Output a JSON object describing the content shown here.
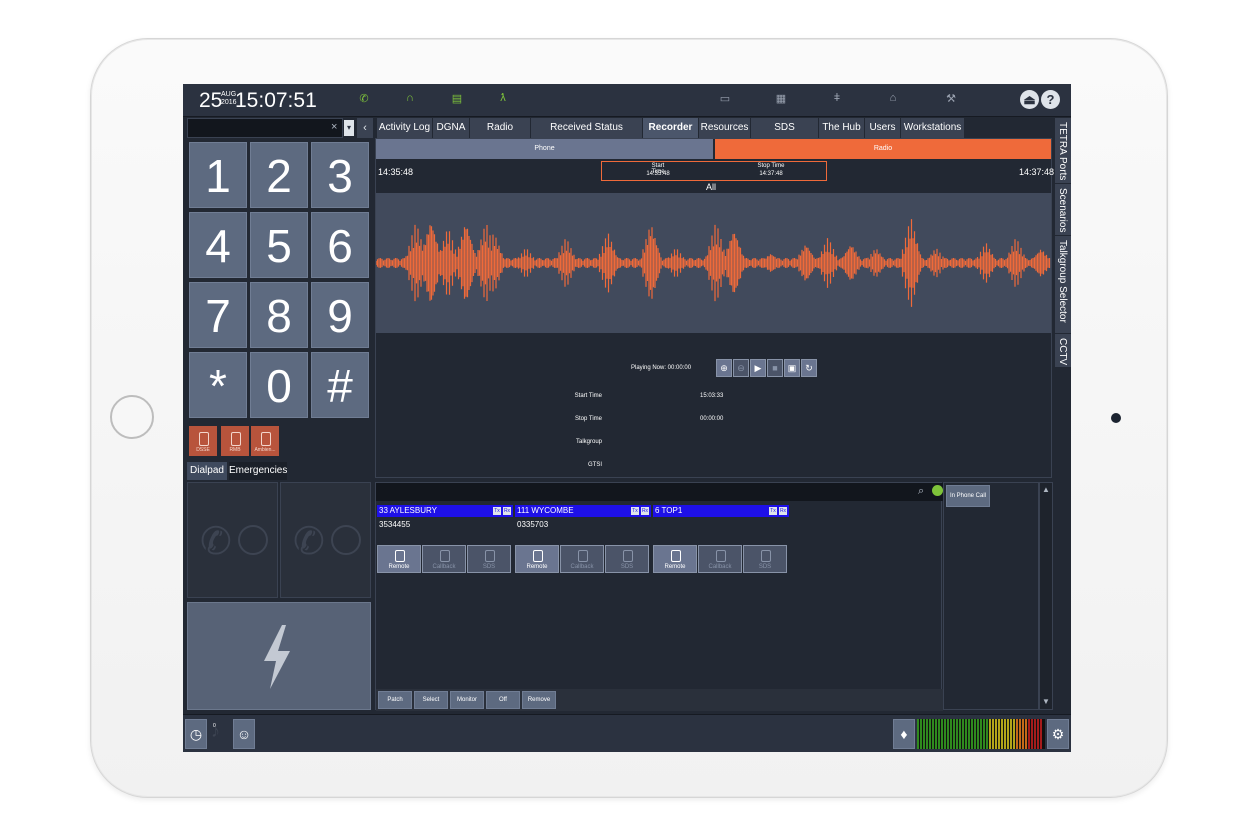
{
  "colors": {
    "accent_orange": "#ef6a3a",
    "call_header_blue": "#1e10e8",
    "status_green": "#7ec33a",
    "key_slate": "#5d6a80",
    "emergency_red": "#b8543c"
  },
  "clock": {
    "day": "25",
    "month": "AUG",
    "year": "2016",
    "time": "15:07:51"
  },
  "topbar": {
    "status_icons": [
      "phone-icon",
      "headset-icon",
      "radio-icon",
      "walking-person-icon"
    ],
    "system_icons": [
      "monitor-icon",
      "grid-icon",
      "thermometer-icon",
      "printer-icon",
      "wrench-icon"
    ],
    "logout_glyph": "⏏",
    "help_glyph": "?"
  },
  "dialpad": {
    "clear_glyph": "×",
    "dropdown_glyph": "▾",
    "back_glyph": "‹",
    "keys": [
      "1",
      "2",
      "3",
      "4",
      "5",
      "6",
      "7",
      "8",
      "9",
      "*",
      "0",
      "#"
    ],
    "emergency_buttons": [
      "DSSE",
      "RMB",
      "Ambien..."
    ],
    "tabs": [
      "Dialpad",
      "Emergencies"
    ]
  },
  "tabs": [
    "Activity Log",
    "DGNA",
    "Radio Search",
    "Received Status Messages",
    "Recorder",
    "Resources",
    "SDS Messages",
    "The Hub",
    "Users",
    "Workstations"
  ],
  "active_tab": "Recorder",
  "side_tabs": [
    "TETRA Ports",
    "Scenarios",
    "Talkgroup Selector",
    "CCTV"
  ],
  "recorder": {
    "phone_label": "Phone",
    "radio_label": "Radio",
    "range_begin": "14:35:48",
    "range_end": "14:37:48",
    "start_time_label": "Start Time",
    "start_time_value": "14:35:48",
    "stop_time_label": "Stop Time",
    "stop_time_value": "14:37:48",
    "filter": "All",
    "playing_now": "Playing Now: 00:00:00",
    "controls": [
      "zoom-in-icon",
      "zoom-out-icon",
      "play-icon",
      "stop-icon",
      "save-icon",
      "refresh-icon"
    ],
    "info": [
      {
        "label": "Start Time",
        "value": "15:03:33"
      },
      {
        "label": "Stop Time",
        "value": "00:00:00"
      },
      {
        "label": "Talkgroup",
        "value": ""
      },
      {
        "label": "GTSI",
        "value": ""
      }
    ]
  },
  "calls": [
    {
      "name": "33 AYLESBURY",
      "number": "3534455",
      "tx": "Tx",
      "rx": "Rx",
      "buttons": [
        "Remote",
        "Callback",
        "SDS"
      ]
    },
    {
      "name": "111 WYCOMBE",
      "number": "0335703",
      "tx": "Tx",
      "rx": "Rx",
      "buttons": [
        "Remote",
        "Callback",
        "SDS"
      ]
    },
    {
      "name": "6 TOP1",
      "number": "",
      "tx": "Tx",
      "rx": "Rx",
      "buttons": [
        "Remote",
        "Callback",
        "SDS"
      ]
    }
  ],
  "call_actions": [
    "Patch",
    "Select",
    "Monitor",
    "Off",
    "Remove"
  ],
  "in_phone_call": "In Phone Call",
  "bottombar": {
    "pending_count": "0"
  }
}
